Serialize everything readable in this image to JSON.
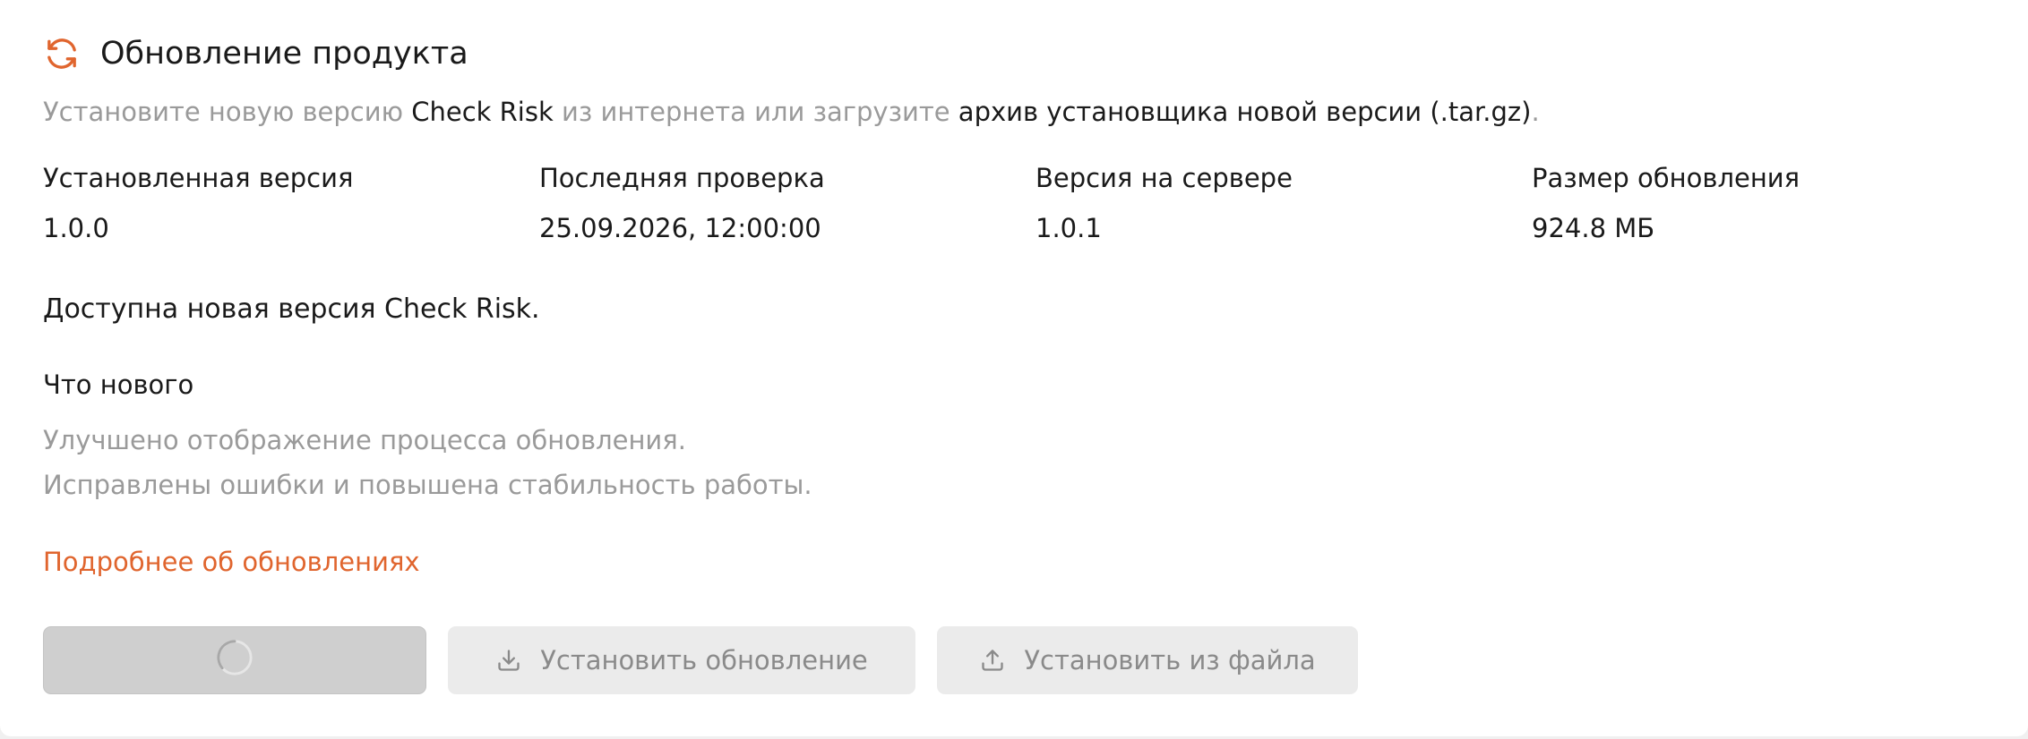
{
  "header": {
    "title": "Обновление продукта",
    "icon": "refresh-icon",
    "icon_color": "#e0652e"
  },
  "subtitle": {
    "part1": "Установите новую версию ",
    "product": "Check Risk",
    "part2": " из интернета или загрузите ",
    "archive": "архив установщика новой версии (.tar.gz)",
    "end": "."
  },
  "info": [
    {
      "label": "Установленная версия",
      "value": "1.0.0"
    },
    {
      "label": "Последняя проверка",
      "value": "25.09.2026, 12:00:00"
    },
    {
      "label": "Версия на сервере",
      "value": "1.0.1"
    },
    {
      "label": "Размер обновления",
      "value": "924.8 МБ"
    }
  ],
  "status": "Доступна новая версия Check Risk.",
  "whats_new": {
    "title": "Что нового",
    "items": [
      "Улучшено отображение процесса обновления.",
      "Исправлены ошибки и повышена стабильность работы."
    ]
  },
  "details_link": "Подробнее об обновлениях",
  "buttons": {
    "check": {
      "icon": "loading-spinner-icon"
    },
    "install_update": {
      "label": "Установить обновление",
      "icon": "download-icon"
    },
    "install_file": {
      "label": "Установить из файла",
      "icon": "upload-icon"
    }
  },
  "colors": {
    "accent": "#e0652e",
    "muted_text": "#9a9a9a",
    "button_disabled": "#ebebeb",
    "button_loading": "#cfcfcf"
  }
}
